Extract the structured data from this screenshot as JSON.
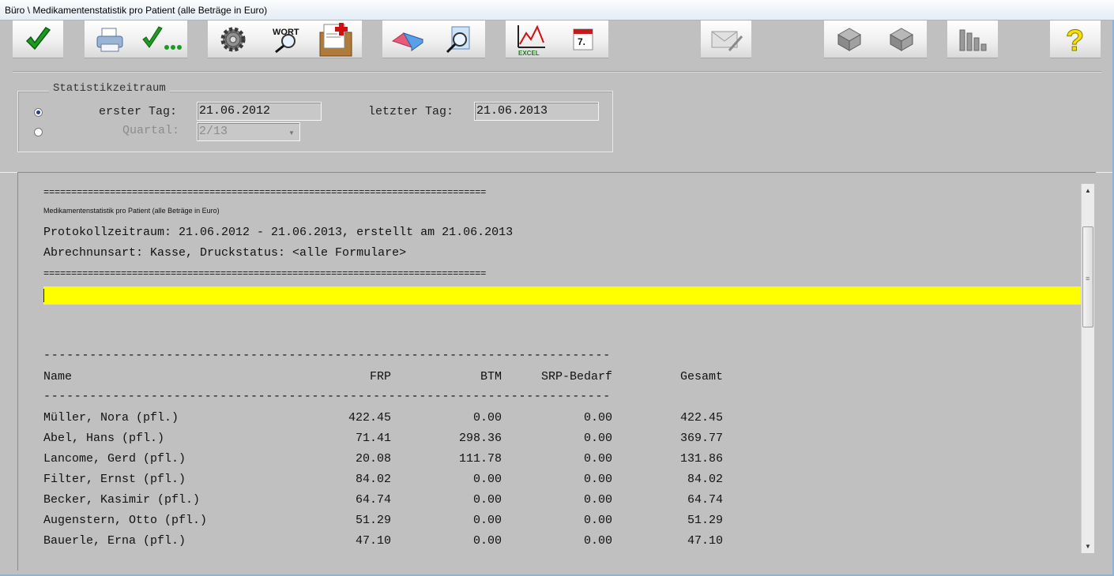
{
  "window": {
    "title": "Büro \\ Medikamentenstatistik pro Patient (alle Beträge in Euro)"
  },
  "toolbar": {
    "buttons": [
      {
        "name": "ok-check-button",
        "icon": "green-check-icon"
      },
      {
        "name": "print-button",
        "icon": "printer-icon"
      },
      {
        "name": "check-more-button",
        "icon": "check-dots-icon"
      },
      {
        "name": "settings-button",
        "icon": "gear-icon"
      },
      {
        "name": "word-search-button",
        "icon": "word-magnifier-icon",
        "label": "WORT"
      },
      {
        "name": "patient-folder-button",
        "icon": "medical-folder-icon"
      },
      {
        "name": "eraser-button",
        "icon": "eraser-icon"
      },
      {
        "name": "document-search-button",
        "icon": "document-magnifier-icon"
      },
      {
        "name": "excel-export-button",
        "icon": "excel-chart-icon",
        "label": "EXCEL"
      },
      {
        "name": "calendar-button",
        "icon": "calendar-icon",
        "label": "7."
      },
      {
        "name": "mail-button",
        "icon": "envelope-pen-icon"
      },
      {
        "name": "tray-up-button",
        "icon": "tray-icon"
      },
      {
        "name": "tray-down-button",
        "icon": "tray-icon"
      },
      {
        "name": "bar-chart-button",
        "icon": "bar-chart-icon"
      },
      {
        "name": "help-button",
        "icon": "question-mark-icon",
        "label": "?"
      }
    ]
  },
  "period": {
    "legend": "Statistikzeitraum",
    "mode": "range",
    "first_day_label": "erster Tag:",
    "first_day_value": "21.06.2012",
    "last_day_label": "letzter Tag:",
    "last_day_value": "21.06.2013",
    "quarter_label": "Quartal:",
    "quarter_value": "2/13"
  },
  "report": {
    "separator_eq": "================================================================================",
    "heading": "Medikamentenstatistik pro Patient (alle Beträge in Euro)",
    "period_line": "Protokollzeitraum: 21.06.2012 - 21.06.2013, erstellt am 21.06.2013",
    "billing_line": "Abrechnunsart: Kasse, Druckstatus: <alle Formulare>",
    "separator_dash": "--------------------------------------------------------------------------",
    "columns": [
      "Name",
      "FRP",
      "BTM",
      "SRP-Bedarf",
      "Gesamt"
    ],
    "rows": [
      [
        "Müller, Nora (pfl.)",
        "422.45",
        "0.00",
        "0.00",
        "422.45"
      ],
      [
        "Abel, Hans (pfl.)",
        "71.41",
        "298.36",
        "0.00",
        "369.77"
      ],
      [
        "Lancome, Gerd (pfl.)",
        "20.08",
        "111.78",
        "0.00",
        "131.86"
      ],
      [
        "Filter, Ernst (pfl.)",
        "84.02",
        "0.00",
        "0.00",
        "84.02"
      ],
      [
        "Becker, Kasimir (pfl.)",
        "64.74",
        "0.00",
        "0.00",
        "64.74"
      ],
      [
        "Augenstern, Otto (pfl.)",
        "51.29",
        "0.00",
        "0.00",
        "51.29"
      ],
      [
        "Bauerle, Erna (pfl.)",
        "47.10",
        "0.00",
        "0.00",
        "47.10"
      ]
    ]
  },
  "colors": {
    "highlight": "#ffff00",
    "background": "#c0c0c0"
  }
}
